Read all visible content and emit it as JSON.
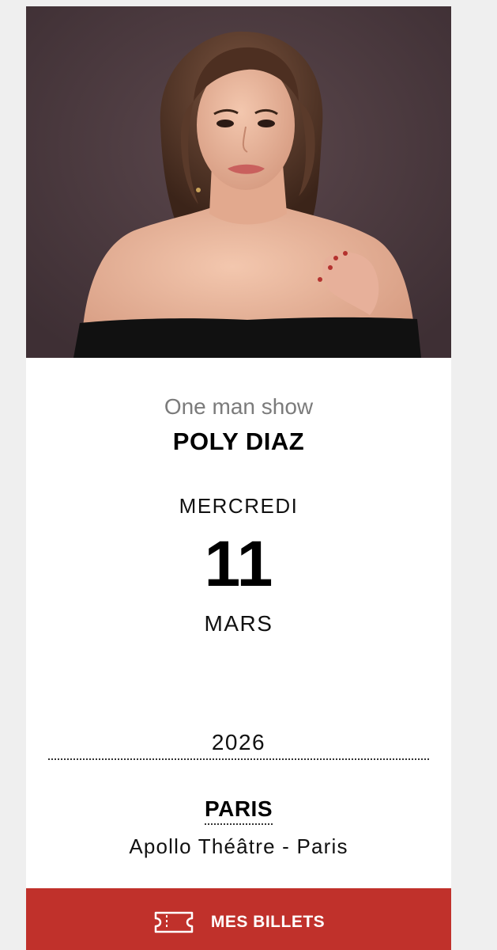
{
  "event": {
    "category": "One man show",
    "artist": "POLY DIAZ",
    "weekday": "MERCREDI",
    "day": "11",
    "month": "MARS",
    "year": "2026",
    "city": "PARIS",
    "venue": "Apollo Théâtre - Paris"
  },
  "actions": {
    "tickets_label": "MES BILLETS",
    "tickets_icon": "ticket-icon"
  },
  "colors": {
    "accent": "#c0312b",
    "photo_background": "#4a383d"
  }
}
